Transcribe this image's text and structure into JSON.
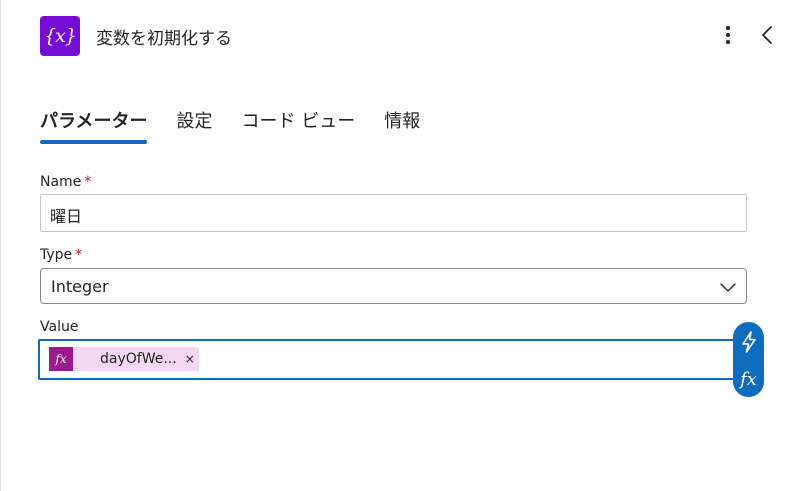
{
  "header": {
    "icon_glyph": "{x}",
    "title": "変数を初期化する",
    "more_icon": "more-vertical-icon",
    "collapse_icon": "chevron-left-icon"
  },
  "tabs": [
    {
      "label": "パラメーター",
      "active": true
    },
    {
      "label": "設定",
      "active": false
    },
    {
      "label": "コード ビュー",
      "active": false
    },
    {
      "label": "情報",
      "active": false
    }
  ],
  "fields": {
    "name": {
      "label": "Name",
      "required_mark": "*",
      "value": "曜日"
    },
    "type": {
      "label": "Type",
      "required_mark": "*",
      "value": "Integer"
    },
    "value": {
      "label": "Value",
      "token": {
        "icon_glyph": "fx",
        "text": "dayOfWe...",
        "remove_glyph": "×"
      }
    }
  },
  "side_buttons": {
    "dynamic_content_icon": "lightning-icon",
    "expression_glyph": "fx"
  },
  "colors": {
    "accent": "#0f6cbd",
    "variable_icon_bg": "#770bd6",
    "token_bg": "#f2d9f1",
    "token_icon_bg": "#9c1a8e",
    "required": "#c50f1f"
  }
}
